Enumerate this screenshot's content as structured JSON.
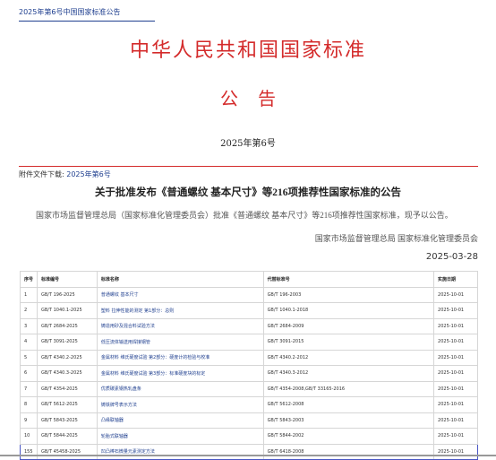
{
  "breadcrumb": "2025年第6号中国国家标准公告",
  "title": "中华人民共和国国家标准",
  "subtitle": "公告",
  "issue": "2025年第6号",
  "attachment": {
    "label": "附件文件下载:",
    "link": "2025年第6号"
  },
  "heading": "关于批准发布《普通螺纹 基本尺寸》等216项推荐性国家标准的公告",
  "body_text": "国家市场监督管理总局（国家标准化管理委员会）批准《普通螺纹 基本尺寸》等216项推荐性国家标准，现予以公告。",
  "signer": "国家市场监督管理总局 国家标准化管理委员会",
  "date": "2025-03-28",
  "table": {
    "headers": [
      "序号",
      "标准编号",
      "标准名称",
      "代替标准号",
      "实施日期"
    ],
    "rows": [
      [
        "1",
        "GB/T 196-2025",
        "普通螺纹 基本尺寸",
        "GB/T 196-2003",
        "2025-10-01"
      ],
      [
        "2",
        "GB/T 1040.1-2025",
        "塑料 拉伸性能的测定 第1部分：总则",
        "GB/T 1040.1-2018",
        "2025-10-01"
      ],
      [
        "3",
        "GB/T 2684-2025",
        "铸造用砂及混合料试验方法",
        "GB/T 2684-2009",
        "2025-10-01"
      ],
      [
        "4",
        "GB/T 3091-2025",
        "低压流体输送用焊接钢管",
        "GB/T 3091-2015",
        "2025-10-01"
      ],
      [
        "5",
        "GB/T 4340.2-2025",
        "金属材料 维氏硬度试验 第2部分：硬度计的检验与校准",
        "GB/T 4340.2-2012",
        "2025-10-01"
      ],
      [
        "6",
        "GB/T 4340.3-2025",
        "金属材料 维氏硬度试验 第3部分：标准硬度块的标定",
        "GB/T 4340.3-2012",
        "2025-10-01"
      ],
      [
        "7",
        "GB/T 4354-2025",
        "优质碳素钢热轧盘条",
        "GB/T 4354-2008,GB/T 33165-2016",
        "2025-10-01"
      ],
      [
        "8",
        "GB/T 5612-2025",
        "铸铁牌号表示方法",
        "GB/T 5612-2008",
        "2025-10-01"
      ],
      [
        "9",
        "GB/T 5843-2025",
        "凸缘联轴器",
        "GB/T 5843-2003",
        "2025-10-01"
      ],
      [
        "10",
        "GB/T 5844-2025",
        "轮胎式联轴器",
        "GB/T 5844-2002",
        "2025-10-01"
      ],
      [
        "155",
        "GB/T 45458-2025",
        "凹凸棒石微量元素测定方法",
        "GB/T 6418-2008",
        "2025-10-01"
      ]
    ]
  }
}
